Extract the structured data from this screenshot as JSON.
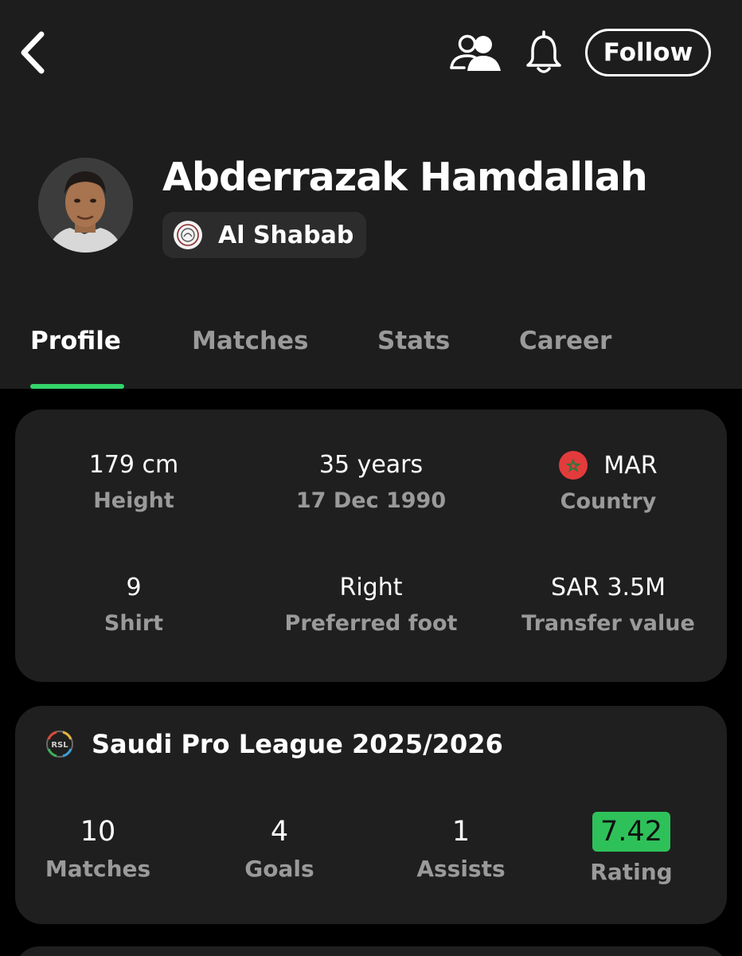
{
  "header": {
    "follow_label": "Follow",
    "icons": {
      "back": "back-chevron-icon",
      "squad": "people-icon",
      "notifications": "bell-icon"
    }
  },
  "player": {
    "name": "Abderrazak Hamdallah",
    "team": "Al Shabab"
  },
  "tabs": [
    {
      "label": "Profile",
      "active": true
    },
    {
      "label": "Matches",
      "active": false
    },
    {
      "label": "Stats",
      "active": false
    },
    {
      "label": "Career",
      "active": false
    }
  ],
  "profile": {
    "height": {
      "value": "179 cm",
      "label": "Height"
    },
    "age": {
      "value": "35 years",
      "label": "17 Dec 1990"
    },
    "country": {
      "value": "MAR",
      "label": "Country"
    },
    "shirt": {
      "value": "9",
      "label": "Shirt"
    },
    "foot": {
      "value": "Right",
      "label": "Preferred foot"
    },
    "transfer": {
      "value": "SAR 3.5M",
      "label": "Transfer value"
    }
  },
  "league": {
    "title": "Saudi Pro League 2025/2026",
    "stats": [
      {
        "value": "10",
        "label": "Matches"
      },
      {
        "value": "4",
        "label": "Goals"
      },
      {
        "value": "1",
        "label": "Assists"
      },
      {
        "value": "7.42",
        "label": "Rating"
      }
    ]
  },
  "colors": {
    "accent": "#35d36a",
    "rating_badge": "#2ec15a",
    "header_bg": "#1d1d1d",
    "card_bg": "#1f1f1f",
    "muted_text": "#9a9a9a"
  }
}
